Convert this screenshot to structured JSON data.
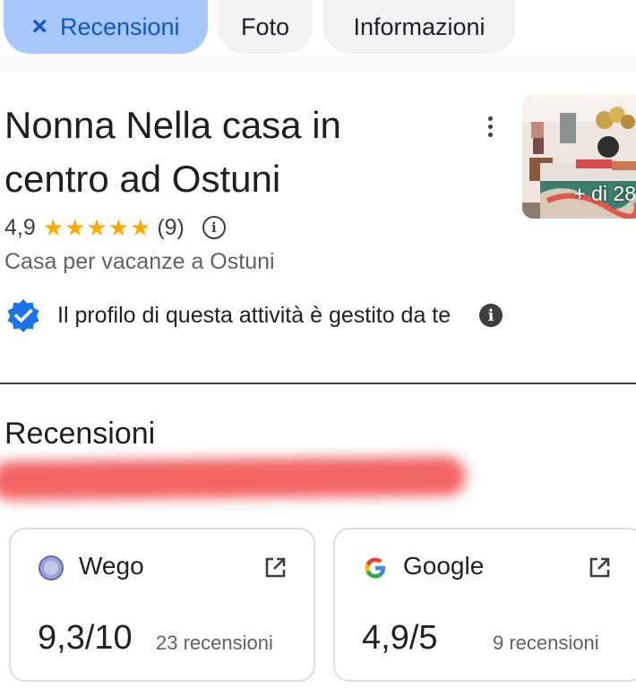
{
  "tabs": [
    {
      "label": "Recensioni",
      "active": true,
      "icon": "close-icon",
      "close_glyph": "×"
    },
    {
      "label": "Foto",
      "active": false
    },
    {
      "label": "Informazioni",
      "active": false
    }
  ],
  "place": {
    "name": "Nonna Nella casa in centro ad Ostuni",
    "rating": "4,9",
    "stars": "★★★★★",
    "stars_value": 4.9,
    "review_count": "(9)",
    "category": "Casa per vacanze a Ostuni",
    "photo_more": "+ di 28",
    "managed_text": "Il profilo di questa attività è gestito da te"
  },
  "reviews_section": {
    "title": "Recensioni",
    "sources": [
      {
        "name": "Wego",
        "score": "9,3/10",
        "count": "23 recensioni",
        "icon": "wego-globe-icon"
      },
      {
        "name": "Google",
        "score": "4,9/5",
        "count": "9 recensioni",
        "icon": "google-g-icon"
      }
    ]
  },
  "colors": {
    "active_chip_bg": "#a8c7fa",
    "active_chip_text": "#0b57d0",
    "star": "#f9ab00",
    "verified_badge": "#1a73e8",
    "redaction": "#f25757"
  }
}
